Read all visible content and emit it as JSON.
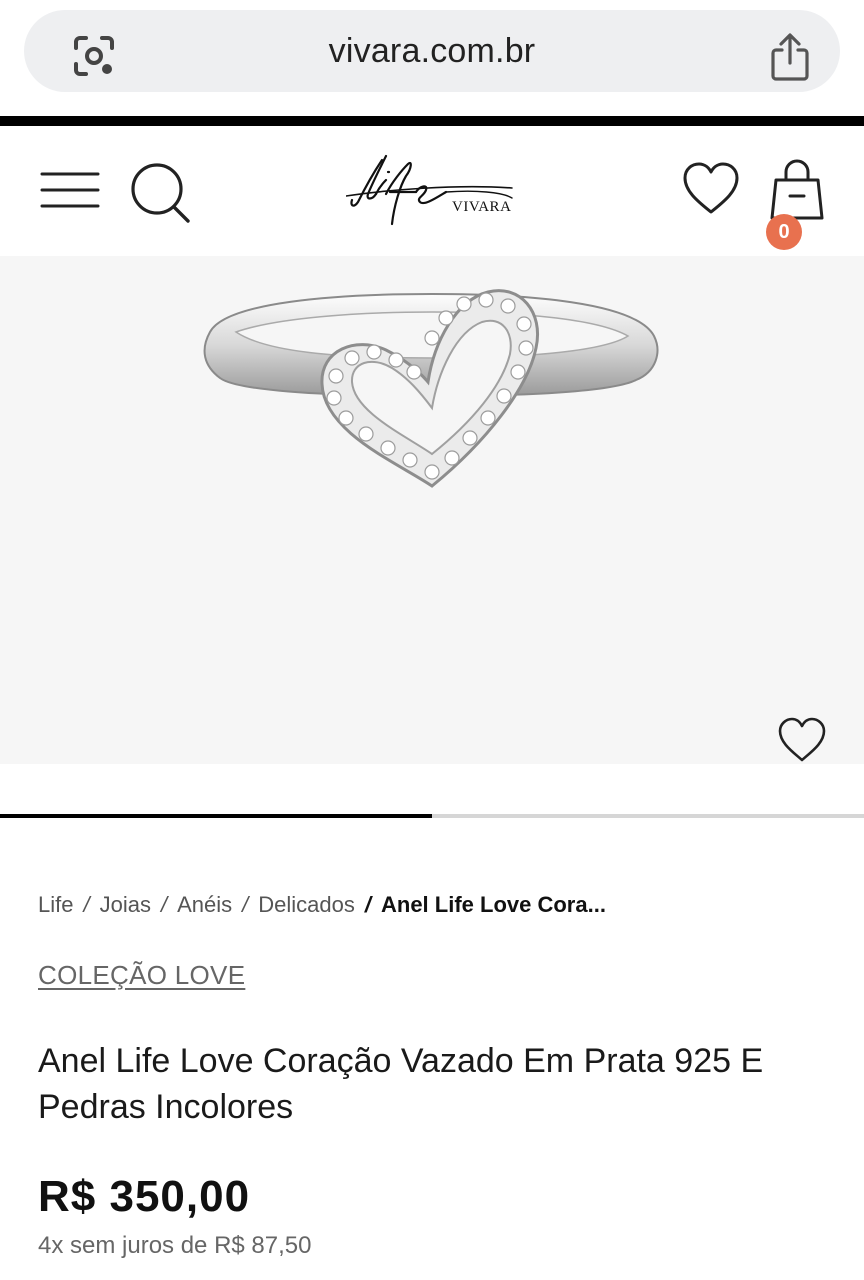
{
  "browser": {
    "url": "vivara.com.br"
  },
  "header": {
    "logo_script": "Life",
    "logo_brand": "VIVARA",
    "cart_count": "0",
    "badge_color": "#e8714f"
  },
  "gallery": {
    "progress": 0.5
  },
  "breadcrumb": {
    "items": [
      "Life",
      "Joias",
      "Anéis",
      "Delicados"
    ],
    "current": "Anel Life Love Cora..."
  },
  "product": {
    "collection": "COLEÇÃO LOVE",
    "title": "Anel Life Love Coração Vazado Em Prata 925 E Pedras Incolores",
    "price": "R$ 350,00",
    "installments": "4x sem juros de R$ 87,50"
  },
  "icons": {
    "lens": "google-lens-icon",
    "share": "share-icon",
    "menu": "hamburger-menu-icon",
    "search": "search-icon",
    "wishlist": "heart-icon",
    "cart": "shopping-bag-icon"
  }
}
